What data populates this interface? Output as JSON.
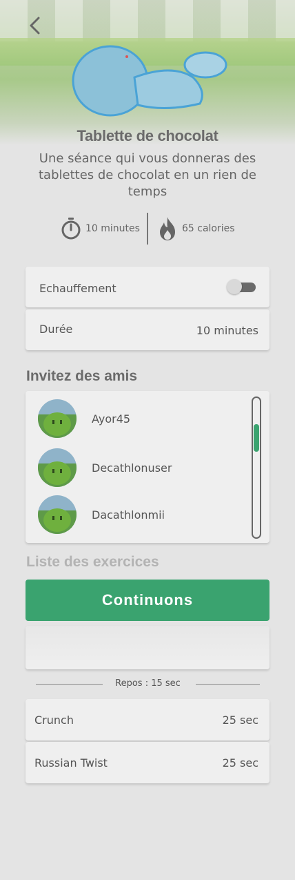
{
  "header": {
    "title": "Tablette de chocolat",
    "subtitle": "Une séance qui vous donneras des tablettes de chocolat en un rien de temps"
  },
  "stats": {
    "duration": "10 minutes",
    "calories": "65 calories"
  },
  "settings": {
    "warmup_label": "Echauffement",
    "warmup_enabled": false,
    "duration_label": "Durée",
    "duration_value": "10 minutes"
  },
  "friends": {
    "title": "Invitez des amis",
    "items": [
      {
        "name": "Ayor45"
      },
      {
        "name": "Decathlonuser"
      },
      {
        "name": "Dacathlonmii"
      }
    ]
  },
  "exercises": {
    "title": "Liste des exercices",
    "rest_label": "Repos : 15 sec",
    "items": [
      {
        "name": "Crunch",
        "duration": "25 sec"
      },
      {
        "name": "Russian Twist",
        "duration": "25 sec"
      }
    ]
  },
  "cta": {
    "label": "Continuons"
  },
  "colors": {
    "accent": "#3aa36f",
    "background": "#e4e4e4",
    "card": "#efefef"
  }
}
